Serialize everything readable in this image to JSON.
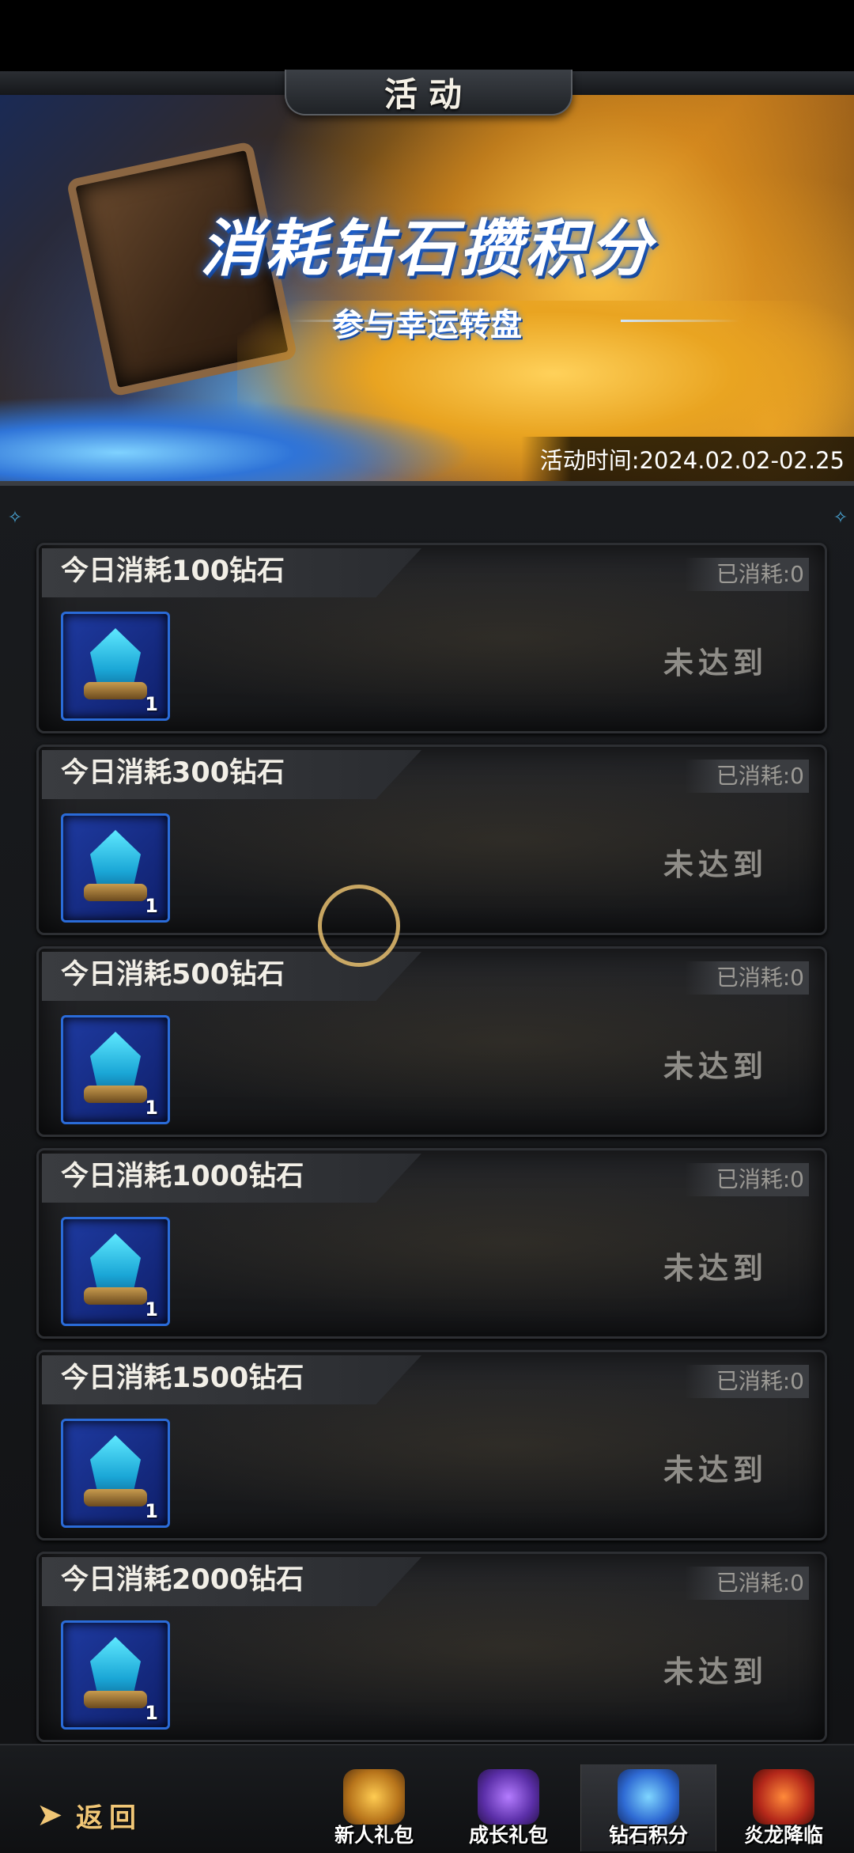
{
  "header": {
    "title": "活动"
  },
  "banner": {
    "title": "消耗钻石攒积分",
    "subtitle": "参与幸运转盘",
    "event_time": "活动时间:2024.02.02-02.25"
  },
  "rewards": [
    {
      "title": "今日消耗100钻石",
      "progress": "已消耗:0",
      "item_count": "1",
      "status": "未达到"
    },
    {
      "title": "今日消耗300钻石",
      "progress": "已消耗:0",
      "item_count": "1",
      "status": "未达到"
    },
    {
      "title": "今日消耗500钻石",
      "progress": "已消耗:0",
      "item_count": "1",
      "status": "未达到"
    },
    {
      "title": "今日消耗1000钻石",
      "progress": "已消耗:0",
      "item_count": "1",
      "status": "未达到"
    },
    {
      "title": "今日消耗1500钻石",
      "progress": "已消耗:0",
      "item_count": "1",
      "status": "未达到"
    },
    {
      "title": "今日消耗2000钻石",
      "progress": "已消耗:0",
      "item_count": "1",
      "status": "未达到"
    }
  ],
  "footer": {
    "back_label": "返回",
    "tabs": [
      {
        "label": "新人礼包",
        "icon": "treasure-chest-icon"
      },
      {
        "label": "成长礼包",
        "icon": "mage-hero-icon"
      },
      {
        "label": "钻石积分",
        "icon": "diamond-knight-icon",
        "active": true
      },
      {
        "label": "炎龙降临",
        "icon": "fire-dragon-icon"
      }
    ]
  }
}
